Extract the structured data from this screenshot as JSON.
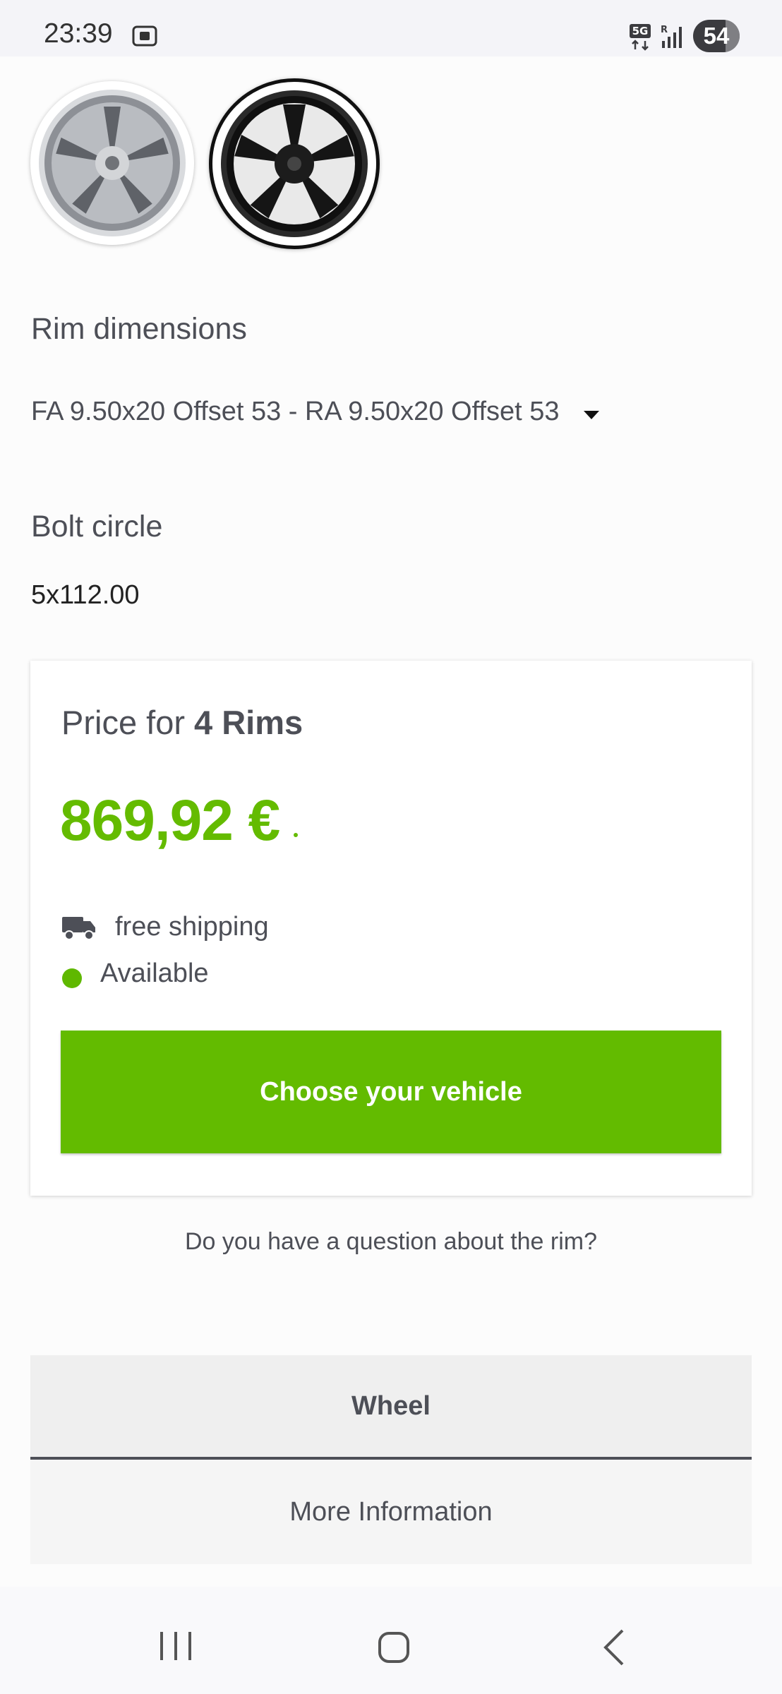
{
  "status_bar": {
    "time": "23:39",
    "battery": "54",
    "network": "5G"
  },
  "rim_thumbnails": [
    {
      "name": "silver rim",
      "color": "#b9bcc1"
    },
    {
      "name": "black rim",
      "color": "#151515",
      "selected": true
    }
  ],
  "rim_dimensions": {
    "label": "Rim dimensions",
    "selected_value": "FA 9.50x20 Offset 53 - RA 9.50x20 Offset 53"
  },
  "bolt_circle": {
    "label": "Bolt circle",
    "value": "5x112.00"
  },
  "price_card": {
    "title_prefix": "Price for ",
    "title_quantity": "4 Rims",
    "price": "869,92 €",
    "shipping": "free shipping",
    "availability": "Available",
    "cta_label": "Choose your vehicle"
  },
  "question_link": "Do you have a question about the rim?",
  "tabs": [
    {
      "label": "Wheel",
      "active": true
    },
    {
      "label": "More Information",
      "active": false
    }
  ],
  "colors": {
    "accent": "#63bb00",
    "text": "#4d4f57",
    "available": "#5fb800"
  },
  "icons": [
    "screen-recorder-icon",
    "5g-icon",
    "signal-icon",
    "truck-icon",
    "dropdown-arrow-icon",
    "recents-icon",
    "home-icon",
    "back-icon"
  ]
}
